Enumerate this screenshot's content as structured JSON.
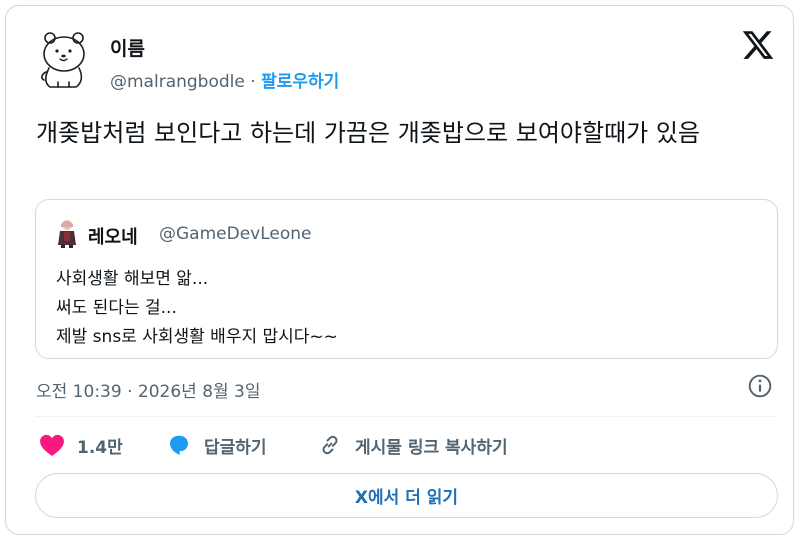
{
  "author": {
    "display_name": "이름",
    "handle": "@malrangbodle",
    "separator": " · ",
    "follow_label": "팔로우하기",
    "avatar_icon": "bear-icon"
  },
  "tweet": {
    "text": "개좆밥처럼 보인다고 하는데 가끔은 개좆밥으로 보여야할때가 있음",
    "timestamp": "오전 10:39 · 2026년 8월 3일"
  },
  "quote": {
    "display_name": "레오네",
    "handle": "@GameDevLeone",
    "lines": [
      "사회생활 해보면 앎...",
      "써도 된다는 걸...",
      "제발 sns로 사회생활 배우지 맙시다~~"
    ]
  },
  "actions": {
    "like_count": "1.4만",
    "reply_label": "답글하기",
    "copy_link_label": "게시물 링크 복사하기"
  },
  "read_more_label": "X에서 더 읽기",
  "colors": {
    "accent": "#1d9bf0",
    "like": "#f91880",
    "muted": "#536471",
    "border": "#cfd9de"
  }
}
